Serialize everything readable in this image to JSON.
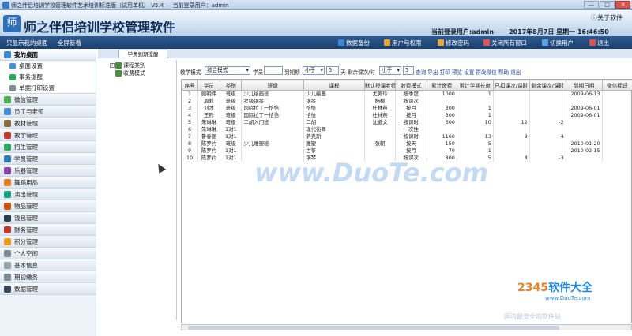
{
  "window": {
    "title": "师之伴侣培训学校管理软件艺术培训标准版（试用单机） V5.4 — 当前登录用户：admin",
    "min": "—",
    "max": "□",
    "close": "✕"
  },
  "banner": {
    "app_name": "师之伴侣培训学校管理软件",
    "about": "关于软件",
    "current_user": "当前登录用户:admin",
    "date": "2017年8月7日 星期一 16:46:50"
  },
  "toolbar": {
    "left_items": [
      "只显示我的桌面",
      "全屏新看"
    ],
    "buttons": [
      {
        "label": "数据备份",
        "color": "#3d86d6"
      },
      {
        "label": "用户与权限",
        "color": "#e8a53a"
      },
      {
        "label": "修改密码",
        "color": "#e8a53a"
      },
      {
        "label": "关闭所有窗口",
        "color": "#d9534f"
      },
      {
        "label": "切换用户",
        "color": "#5aa2e6"
      },
      {
        "label": "退出",
        "color": "#d9534f"
      }
    ]
  },
  "sidebar": {
    "desktop": {
      "label": "我的桌面",
      "items": [
        "桌面设置",
        "事务提醒",
        "单据打印设置"
      ]
    },
    "sections": [
      {
        "label": "微信管理",
        "color": "#4caf50"
      },
      {
        "label": "员工与老师",
        "color": "#4a90d9"
      },
      {
        "label": "教材管理",
        "color": "#8a6d3b"
      },
      {
        "label": "教学管理",
        "color": "#c0392b"
      },
      {
        "label": "招生管理",
        "color": "#27ae60"
      },
      {
        "label": "学员管理",
        "color": "#2980b9"
      },
      {
        "label": "乐器管理",
        "color": "#8e44ad"
      },
      {
        "label": "舞蹈用品",
        "color": "#e67e22"
      },
      {
        "label": "演出管理",
        "color": "#16a085"
      },
      {
        "label": "物品管理",
        "color": "#d35400"
      },
      {
        "label": "钱包管理",
        "color": "#2c3e50"
      },
      {
        "label": "财务管理",
        "color": "#c0392b"
      },
      {
        "label": "积分管理",
        "color": "#f39c12"
      },
      {
        "label": "个人空间",
        "color": "#7f8c8d"
      },
      {
        "label": "基本信息",
        "color": "#95a5a6"
      },
      {
        "label": "期初缴务",
        "color": "#7f8c8d"
      },
      {
        "label": "数据管理",
        "color": "#34495e"
      }
    ]
  },
  "tab": {
    "label": "学费到期提醒"
  },
  "tree": {
    "nodes": [
      "课程类别",
      "收费模式"
    ]
  },
  "filter": {
    "teach_mode_label": "教学模式",
    "teach_mode_value": "综合模式",
    "student_label": "学员",
    "student_value": "",
    "due_label": "到期期",
    "due_op": "小于",
    "due_value": "5",
    "due_unit": "天 剩余课次/时",
    "remain_op": "小于",
    "remain_value": "5",
    "actions": "查询 导出 打印 预览 设置 群发微信 帮助 退出"
  },
  "table": {
    "headers": [
      "序号",
      "学员",
      "类别",
      "班级",
      "课程",
      "默认授课老师",
      "收费模式",
      "累计缴费",
      "累计学期长度",
      "已扣课次/课时",
      "剩余课次/课时",
      "到期日期",
      "微信标识"
    ],
    "rows": [
      [
        "1",
        "顾明伟",
        "班级",
        "少儿绘画班",
        "少儿绘画",
        "尤美玲",
        "按季度",
        "1000",
        "1",
        "",
        "",
        "2009-06-13",
        ""
      ],
      [
        "2",
        "周莉",
        "班级",
        "考级钢琴",
        "钢琴",
        "杨柳",
        "按课次",
        "",
        "",
        "",
        "",
        "",
        ""
      ],
      [
        "3",
        "刘才",
        "班级",
        "国际拉丁一恰恰",
        "恰恰",
        "杜林燕",
        "按月",
        "300",
        "1",
        "",
        "",
        "2009-06-01",
        ""
      ],
      [
        "4",
        "王煦",
        "班级",
        "国际拉丁一恰恰",
        "恰恰",
        "杜林燕",
        "按月",
        "300",
        "1",
        "",
        "",
        "2009-06-01",
        ""
      ],
      [
        "5",
        "朱琳琳",
        "班级",
        "二胡入门班",
        "二胡",
        "沈道文",
        "按课时",
        "500",
        "10",
        "12",
        "-2",
        "",
        ""
      ],
      [
        "6",
        "朱琳琳",
        "1对1",
        "",
        "现代街舞",
        "",
        "一次性",
        "",
        "",
        "",
        "",
        "",
        ""
      ],
      [
        "7",
        "鲁春丽",
        "1对1",
        "",
        "萨克斯",
        "",
        "按课时",
        "1160",
        "13",
        "9",
        "4",
        "",
        ""
      ],
      [
        "8",
        "陈罗约",
        "班级",
        "少儿雕塑班",
        "雕塑",
        "张朝",
        "按天",
        "150",
        "5",
        "",
        "",
        "2010-01-20",
        ""
      ],
      [
        "9",
        "陈罗约",
        "1对1",
        "",
        "古筝",
        "",
        "按月",
        "70",
        "1",
        "",
        "",
        "2010-02-15",
        ""
      ],
      [
        "10",
        "陈罗约",
        "1对1",
        "",
        "钢琴",
        "",
        "按课次",
        "800",
        "5",
        "8",
        "-3",
        "",
        ""
      ]
    ]
  },
  "watermarks": {
    "main": "www.DuoTe.com",
    "brand_num": "2345",
    "brand_text": "软件大全",
    "site": "www.DuoTe.com",
    "slogan": "国内最安全的软件站"
  }
}
